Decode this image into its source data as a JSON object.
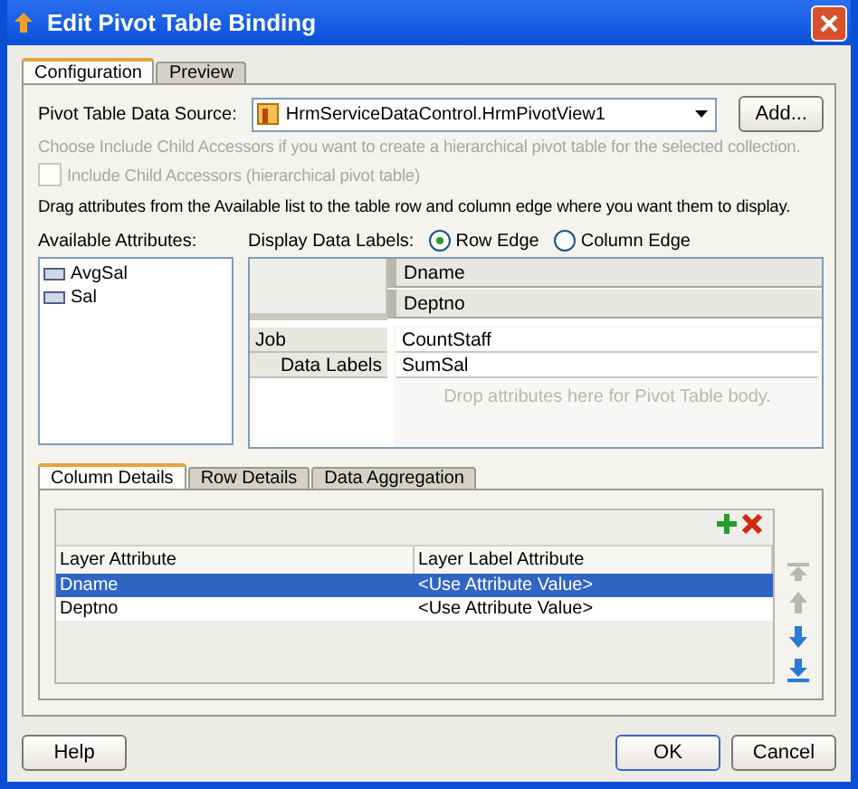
{
  "window": {
    "title": "Edit Pivot Table Binding"
  },
  "tabs": [
    {
      "label": "Configuration",
      "selected": true
    },
    {
      "label": "Preview",
      "selected": false
    }
  ],
  "data_source": {
    "label": "Pivot Table Data Source:",
    "value": "HrmServiceDataControl.HrmPivotView1",
    "button": "Add..."
  },
  "hint": "Choose Include Child Accessors if you want to create a hierarchical pivot table for the selected collection.",
  "include_child": {
    "label": "Include Child Accessors (hierarchical pivot table)",
    "checked": false,
    "disabled": true
  },
  "instructions": "Drag attributes from the Available list to the table row and column edge where you want them to display.",
  "available": {
    "label": "Available Attributes:",
    "items": [
      "AvgSal",
      "Sal"
    ]
  },
  "display_labels": {
    "label": "Display Data Labels:",
    "options": [
      {
        "label": "Row Edge",
        "selected": true
      },
      {
        "label": "Column Edge",
        "selected": false
      }
    ]
  },
  "pivot": {
    "column_edge": [
      "Dname",
      "Deptno"
    ],
    "row_edge": [
      "Job",
      "Data Labels"
    ],
    "data": [
      "CountStaff",
      "SumSal"
    ],
    "drop_hint": "Drop attributes here for Pivot Table body."
  },
  "detail_tabs": [
    {
      "label": "Column Details",
      "selected": true
    },
    {
      "label": "Row Details",
      "selected": false
    },
    {
      "label": "Data Aggregation",
      "selected": false
    }
  ],
  "layer_table": {
    "columns": [
      "Layer Attribute",
      "Layer Label Attribute"
    ],
    "rows": [
      {
        "cells": [
          "Dname",
          "<Use Attribute Value>"
        ],
        "selected": true
      },
      {
        "cells": [
          "Deptno",
          "<Use Attribute Value>"
        ],
        "selected": false
      }
    ]
  },
  "move_buttons": [
    {
      "kind": "top",
      "disabled": true
    },
    {
      "kind": "up",
      "disabled": true
    },
    {
      "kind": "down",
      "disabled": false
    },
    {
      "kind": "bottom",
      "disabled": false
    }
  ],
  "buttons": [
    {
      "label": "Help",
      "default": false
    },
    {
      "label": "OK",
      "default": true
    },
    {
      "label": "Cancel",
      "default": false
    }
  ]
}
